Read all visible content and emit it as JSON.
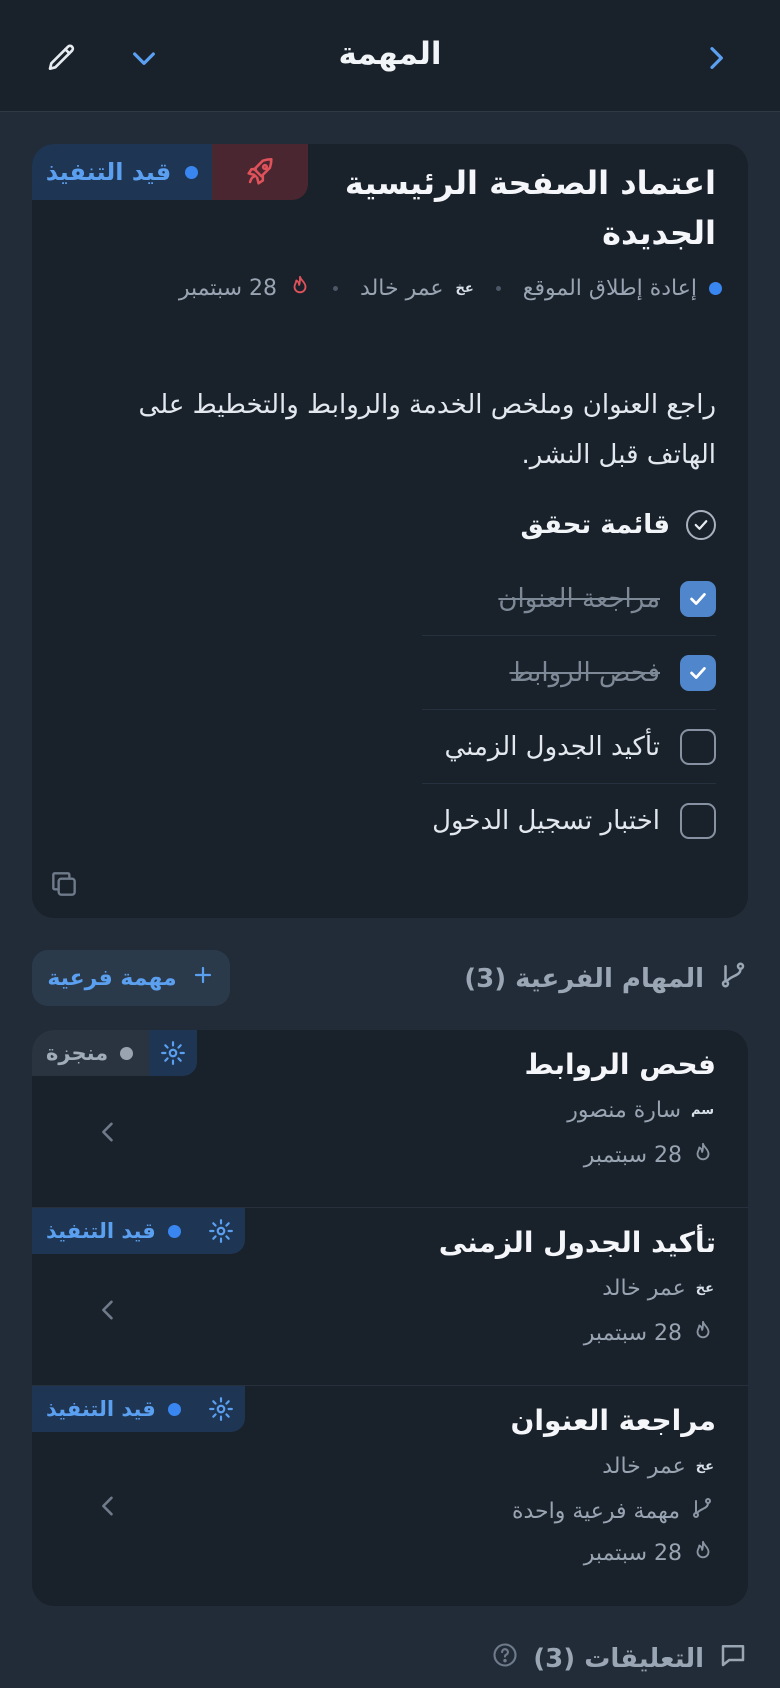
{
  "header": {
    "title": "المهمة"
  },
  "task": {
    "status": "قيد التنفيذ",
    "title_line1": "اعتماد الصفحة الرئيسية",
    "title_line2": "الجديدة",
    "project": "إعادة إطلاق الموقع",
    "assignee_initials": "عخ",
    "assignee": "عمر خالد",
    "due": "28 سبتمبر",
    "description_line1": "راجع العنوان وملخص الخدمة والروابط والتخطيط على",
    "description_line2": "الهاتف قبل النشر."
  },
  "checklist": {
    "title": "قائمة تحقق",
    "items": [
      {
        "label": "مراجعة العنوان",
        "checked": true
      },
      {
        "label": "فحص الروابط",
        "checked": true
      },
      {
        "label": "تأكيد الجدول الزمني",
        "checked": false
      },
      {
        "label": "اختبار تسجيل الدخول",
        "checked": false
      }
    ]
  },
  "subtasks": {
    "heading": "المهام الفرعية (3)",
    "add_label": "مهمة فرعية",
    "items": [
      {
        "status": "منجزة",
        "title": "فحص الروابط",
        "initials": "سم",
        "assignee": "سارة منصور",
        "due": "28 سبتمبر"
      },
      {
        "status": "قيد التنفيذ",
        "title": "تأكيد الجدول الزمنى",
        "initials": "عخ",
        "assignee": "عمر خالد",
        "due": "28 سبتمبر"
      },
      {
        "status": "قيد التنفيذ",
        "title": "مراجعة العنوان",
        "initials": "عخ",
        "assignee": "عمر خالد",
        "subtasks": "مهمة فرعية واحدة",
        "due": "28 سبتمبر"
      }
    ]
  },
  "comments": {
    "heading": "التعليقات (3)"
  },
  "colors": {
    "accent": "#3a86f0",
    "background": "#222c38",
    "card": "#19212b",
    "danger": "#e0525a"
  },
  "icons": [
    "pencil-icon",
    "chevron-down-icon",
    "chevron-right-icon",
    "rocket-icon",
    "flame-icon",
    "check-circle-icon",
    "copy-icon",
    "branch-icon",
    "plus-icon",
    "gear-icon",
    "chevron-left-icon",
    "comment-icon",
    "help-icon"
  ]
}
